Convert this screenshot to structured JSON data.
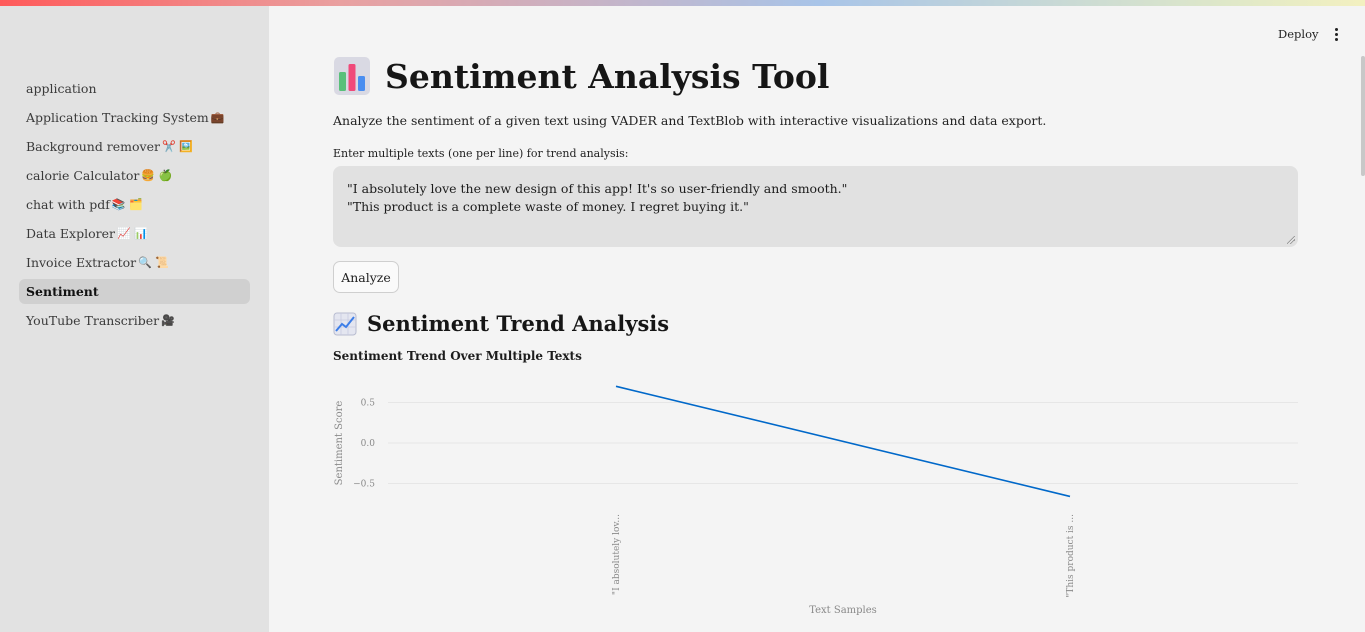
{
  "header": {
    "deploy_label": "Deploy",
    "menu_icon": "kebab-menu-icon"
  },
  "sidebar": {
    "items": [
      {
        "label": "application",
        "emoji": "",
        "active": false
      },
      {
        "label": "Application Tracking System",
        "emoji": "💼",
        "active": false
      },
      {
        "label": "Background remover",
        "emoji": "✂️ 🖼️",
        "active": false
      },
      {
        "label": "calorie Calculator",
        "emoji": "🍔 🍏",
        "active": false
      },
      {
        "label": "chat with pdf",
        "emoji": "📚 🗂️",
        "active": false
      },
      {
        "label": "Data Explorer ",
        "emoji": "📈 📊",
        "active": false
      },
      {
        "label": "Invoice Extractor",
        "emoji": "🔍 📜",
        "active": false
      },
      {
        "label": "Sentiment",
        "emoji": "",
        "active": true
      },
      {
        "label": "YouTube Transcriber",
        "emoji": "🎥",
        "active": false
      }
    ]
  },
  "main": {
    "title": "Sentiment Analysis Tool",
    "title_icon": "bar-chart-icon",
    "subtitle": "Analyze the sentiment of a given text using VADER and TextBlob with interactive visualizations and data export.",
    "textarea_label": "Enter multiple texts (one per line) for trend analysis:",
    "textarea_lines": [
      "\"I absolutely love the new design of this app! It's so user-friendly and smooth.\"",
      "\"This product is a complete waste of money. I regret buying it.\""
    ],
    "analyze_label": "Analyze",
    "section_title": "Sentiment Trend Analysis",
    "section_icon": "trend-chart-icon"
  },
  "chart_data": {
    "type": "line",
    "title": "Sentiment Trend Over Multiple Texts",
    "xlabel": "Text Samples",
    "ylabel": "Sentiment Score",
    "categories": [
      "\"I absolutely lov...",
      "\"This product is ..."
    ],
    "values": [
      0.7,
      -0.66
    ],
    "yticks": [
      0.5,
      0.0,
      -0.5
    ],
    "ytick_labels": [
      "0.5",
      "0.0",
      "−0.5"
    ],
    "ylim": [
      -0.75,
      0.8
    ],
    "grid": true,
    "line_color": "#0068c9"
  }
}
